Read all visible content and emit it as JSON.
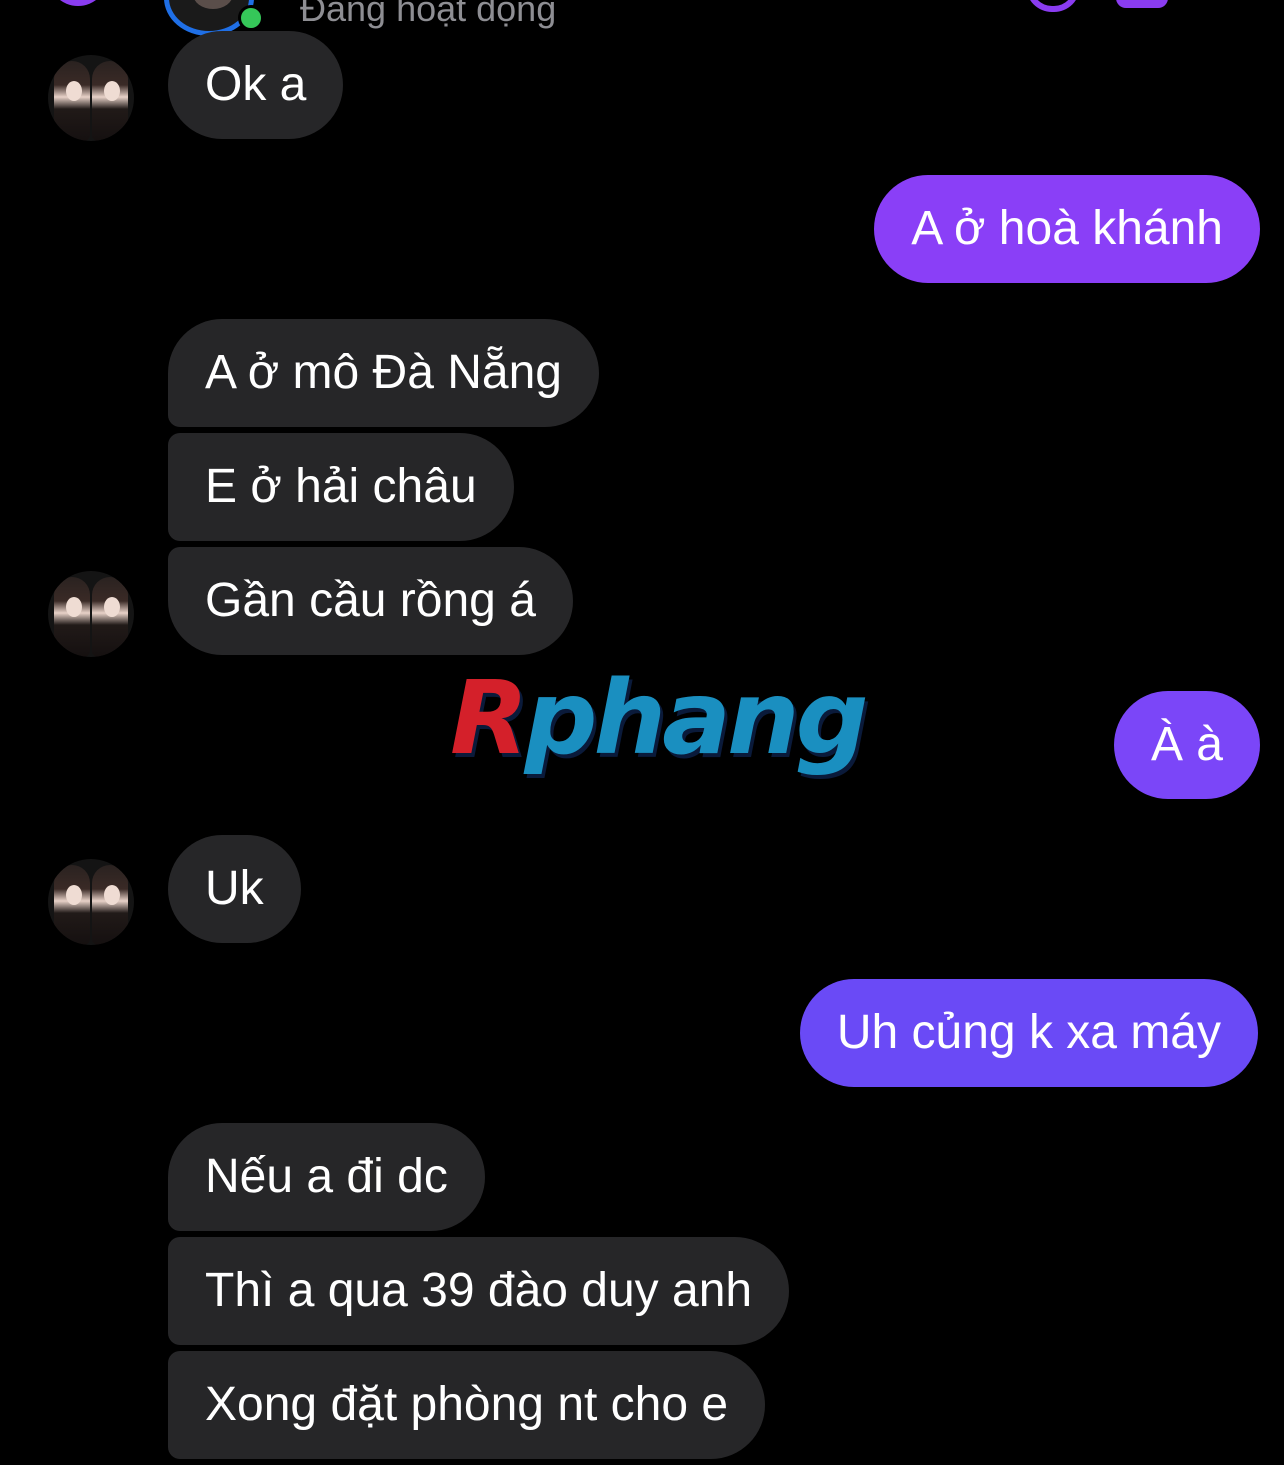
{
  "header": {
    "status_text": "Đang hoạt động"
  },
  "colors": {
    "outgoing_bubble": "#7a3cff",
    "incoming_bubble": "#262628",
    "accent": "#8a3cf0",
    "online": "#35c759",
    "background": "#000000"
  },
  "messages": [
    {
      "direction": "incoming",
      "text": "Ok a"
    },
    {
      "direction": "outgoing",
      "text": "A ở hoà khánh"
    },
    {
      "direction": "incoming",
      "text": "A ở mô Đà Nẵng"
    },
    {
      "direction": "incoming",
      "text": "E ở hải châu"
    },
    {
      "direction": "incoming",
      "text": "Gần cầu rồng á"
    },
    {
      "direction": "outgoing",
      "text": "À à"
    },
    {
      "direction": "incoming",
      "text": "Uk"
    },
    {
      "direction": "outgoing",
      "text": "Uh củng k xa máy"
    },
    {
      "direction": "incoming",
      "text": "Nếu a đi dc"
    },
    {
      "direction": "incoming",
      "text": "Thì a qua 39 đào duy anh"
    },
    {
      "direction": "incoming",
      "text": "Xong đặt phòng nt cho e"
    }
  ],
  "watermark": {
    "first_letter": "R",
    "rest": "phang"
  },
  "icons": [
    "back-icon",
    "call-icon",
    "video-icon",
    "online-dot-icon"
  ]
}
